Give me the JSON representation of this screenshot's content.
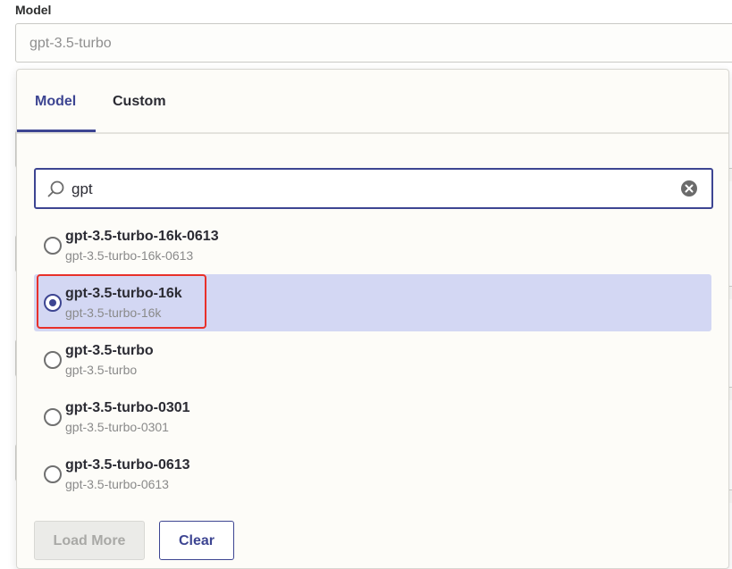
{
  "field": {
    "label": "Model",
    "value": "gpt-3.5-turbo"
  },
  "dropdown": {
    "tabs": [
      {
        "label": "Model",
        "active": true
      },
      {
        "label": "Custom",
        "active": false
      }
    ],
    "search": {
      "value": "gpt",
      "icon": "search-icon",
      "clear_icon": "clear-icon"
    },
    "options": [
      {
        "title": "gpt-3.5-turbo-16k-0613",
        "subtitle": "gpt-3.5-turbo-16k-0613",
        "selected": false
      },
      {
        "title": "gpt-3.5-turbo-16k",
        "subtitle": "gpt-3.5-turbo-16k",
        "selected": true
      },
      {
        "title": "gpt-3.5-turbo",
        "subtitle": "gpt-3.5-turbo",
        "selected": false
      },
      {
        "title": "gpt-3.5-turbo-0301",
        "subtitle": "gpt-3.5-turbo-0301",
        "selected": false
      },
      {
        "title": "gpt-3.5-turbo-0613",
        "subtitle": "gpt-3.5-turbo-0613",
        "selected": false
      }
    ],
    "buttons": {
      "load_more": "Load More",
      "clear": "Clear"
    }
  },
  "colors": {
    "accent": "#3d4592",
    "selected_bg": "#d3d7f3",
    "highlight": "#e8302a"
  }
}
